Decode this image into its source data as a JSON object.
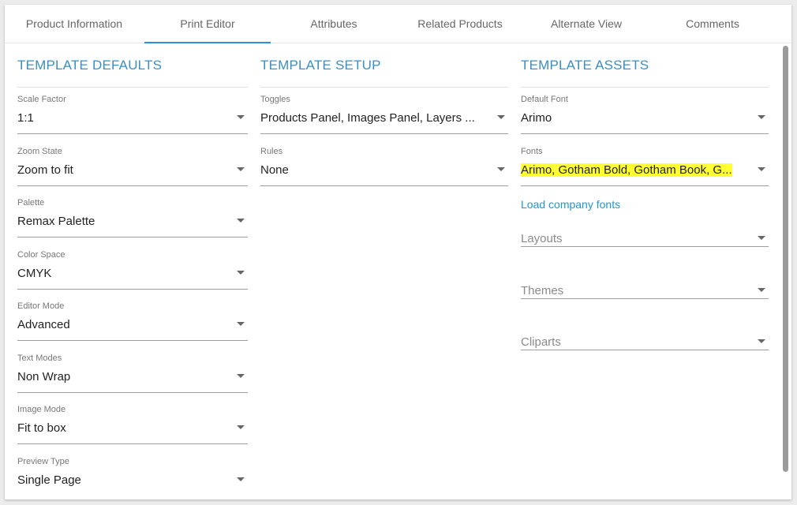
{
  "tabs": [
    {
      "label": "Product Information"
    },
    {
      "label": "Print Editor",
      "active": true
    },
    {
      "label": "Attributes"
    },
    {
      "label": "Related Products"
    },
    {
      "label": "Alternate View"
    },
    {
      "label": "Comments"
    }
  ],
  "template_defaults": {
    "title": "TEMPLATE DEFAULTS",
    "fields": [
      {
        "label": "Scale Factor",
        "value": "1:1"
      },
      {
        "label": "Zoom State",
        "value": "Zoom to fit"
      },
      {
        "label": "Palette",
        "value": "Remax Palette"
      },
      {
        "label": "Color Space",
        "value": "CMYK"
      },
      {
        "label": "Editor Mode",
        "value": "Advanced"
      },
      {
        "label": "Text Modes",
        "value": "Non Wrap"
      },
      {
        "label": "Image Mode",
        "value": "Fit to box"
      },
      {
        "label": "Preview Type",
        "value": "Single Page"
      }
    ]
  },
  "template_setup": {
    "title": "TEMPLATE SETUP",
    "fields": [
      {
        "label": "Toggles",
        "value": "Products Panel, Images Panel, Layers ..."
      },
      {
        "label": "Rules",
        "value": "None"
      }
    ]
  },
  "template_assets": {
    "title": "TEMPLATE ASSETS",
    "default_font": {
      "label": "Default Font",
      "value": "Arimo"
    },
    "fonts": {
      "label": "Fonts",
      "value": "Arimo, Gotham Bold, Gotham Book, G..."
    },
    "load_fonts_link": "Load company fonts",
    "layouts_placeholder": "Layouts",
    "themes_placeholder": "Themes",
    "cliparts_placeholder": "Cliparts"
  },
  "colors": {
    "accent": "#2196d3",
    "section_title": "#3a8fc3",
    "highlight": "#ffff33"
  }
}
